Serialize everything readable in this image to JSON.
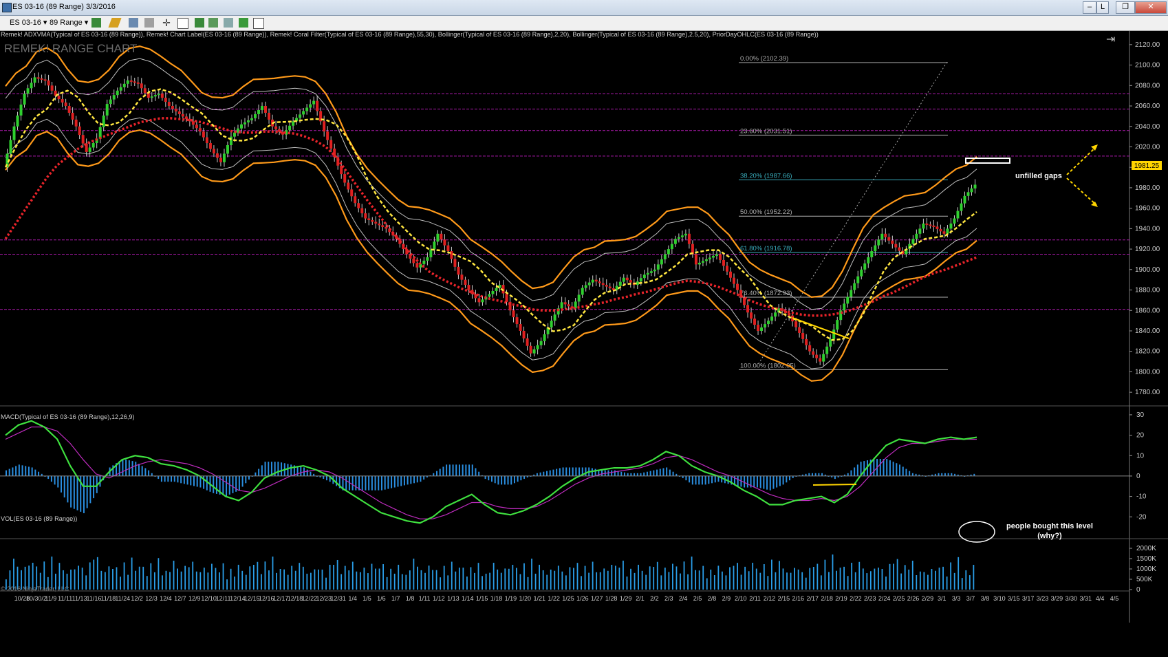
{
  "window": {
    "title": "ES 03-16 (89 Range)  3/3/2016",
    "buttons": [
      "–",
      "L",
      "❐",
      "✕"
    ]
  },
  "toolbar": {
    "instrument": "ES 03-16",
    "period": "89 Range"
  },
  "price_panel": {
    "indicators_label": "Remek! ADXVMA(Typical of ES 03-16 (89 Range)), Remek! Chart Label(ES 03-16 (89 Range)), Remek! Coral Filter(Typical of ES 03-16 (89 Range),55,30), Bollinger(Typical of ES 03-16 (89 Range),2,20), Bollinger(Typical of ES 03-16 (89 Range),2.5,20), PriorDayOHLC(ES 03-16 (89 Range))",
    "watermark": "REMEK! RANGE CHART",
    "current_price": "1981.25",
    "fib_levels": [
      {
        "label": "0.00% (2102.39)",
        "price": 2102.39
      },
      {
        "label": "23.60% (2031.51)",
        "price": 2031.51
      },
      {
        "label": "38.20% (1987.66)",
        "price": 1987.66
      },
      {
        "label": "50.00% (1952.22)",
        "price": 1952.22
      },
      {
        "label": "61.80% (1916.78)",
        "price": 1916.78
      },
      {
        "label": "76.40% (1872.93)",
        "price": 1872.93
      },
      {
        "label": "100.00% (1802.05)",
        "price": 1802.05
      }
    ],
    "annotations": {
      "gaps": "unfilled gaps"
    }
  },
  "macd_panel": {
    "label": "MACD(Typical of ES 03-16 (89 Range),12,26,9)"
  },
  "volume_panel": {
    "label": "VOL(ES 03-16 (89 Range))",
    "note_line1": "people bought this level",
    "note_line2": "(why?)"
  },
  "copyright": "© 2016 NinjaTrader, LLC",
  "chart_data": [
    {
      "type": "line",
      "title": "",
      "ylim": [
        1770,
        2130
      ],
      "y_ticks": [
        "2120.00",
        "2100.00",
        "2080.00",
        "2060.00",
        "2040.00",
        "2020.00",
        "2000.00",
        "1980.00",
        "1960.00",
        "1940.00",
        "1920.00",
        "1900.00",
        "1880.00",
        "1860.00",
        "1840.00",
        "1820.00",
        "1800.00",
        "1780.00"
      ],
      "x_ticks": [
        "10/28",
        "10/30/2",
        "11/9",
        "11/11",
        "11/13",
        "11/16",
        "11/18",
        "11/24",
        "12/2",
        "12/3",
        "12/4",
        "12/7",
        "12/9",
        "12/10",
        "12/11",
        "12/14",
        "12/15",
        "12/16",
        "12/17",
        "12/18",
        "12/22",
        "12/23",
        "12/31",
        "1/4",
        "1/5",
        "1/6",
        "1/7",
        "1/8",
        "1/11",
        "1/12",
        "1/13",
        "1/14",
        "1/15",
        "1/18",
        "1/19",
        "1/20",
        "1/21",
        "1/22",
        "1/25",
        "1/26",
        "1/27",
        "1/28",
        "1/29",
        "2/1",
        "2/2",
        "2/3",
        "2/4",
        "2/5",
        "2/8",
        "2/9",
        "2/10",
        "2/11",
        "2/12",
        "2/15",
        "2/16",
        "2/17",
        "2/18",
        "2/19",
        "2/22",
        "2/23",
        "2/24",
        "2/25",
        "2/26",
        "2/29",
        "3/1",
        "3/3",
        "3/7",
        "3/8",
        "3/10",
        "3/15",
        "3/17",
        "3/23",
        "3/29",
        "3/30",
        "3/31",
        "4/4",
        "4/5"
      ],
      "horizontal_levels": [
        2072,
        2057,
        2036,
        2011,
        1929,
        1915,
        1861
      ],
      "series": [
        {
          "values": [
            2000,
            2040,
            2072,
            2088,
            2085,
            2070,
            2060,
            2040,
            2015,
            2028,
            2062,
            2075,
            2085,
            2082,
            2068,
            2072,
            2060,
            2052,
            2045,
            2035,
            2018,
            2005,
            2030,
            2042,
            2048,
            2060,
            2040,
            2032,
            2045,
            2055,
            2065,
            2035,
            2010,
            1985,
            1965,
            1950,
            1945,
            1940,
            1930,
            1915,
            1902,
            1912,
            1935,
            1918,
            1895,
            1880,
            1868,
            1876,
            1885,
            1860,
            1840,
            1818,
            1830,
            1850,
            1868,
            1862,
            1882,
            1890,
            1885,
            1880,
            1892,
            1885,
            1895,
            1900,
            1915,
            1930,
            1935,
            1905,
            1910,
            1915,
            1898,
            1880,
            1858,
            1840,
            1850,
            1862,
            1855,
            1838,
            1820,
            1810,
            1832,
            1860,
            1880,
            1900,
            1918,
            1935,
            1925,
            1915,
            1930,
            1945,
            1942,
            1935,
            1950,
            1972,
            1983
          ]
        },
        {
          "values": [
            1930,
            1945,
            1960,
            1975,
            1990,
            2002,
            2010,
            2018,
            2024,
            2028,
            2032,
            2036,
            2040,
            2044,
            2046,
            2048,
            2048,
            2047,
            2046,
            2044,
            2041,
            2038,
            2035,
            2034,
            2034,
            2035,
            2035,
            2034,
            2033,
            2030,
            2026,
            2020,
            2010,
            1996,
            1982,
            1968,
            1955,
            1942,
            1930,
            1918,
            1907,
            1898,
            1892,
            1887,
            1882,
            1878,
            1874,
            1871,
            1869,
            1866,
            1864,
            1861,
            1860,
            1860,
            1861,
            1862,
            1864,
            1866,
            1868,
            1871,
            1873,
            1876,
            1878,
            1881,
            1884,
            1887,
            1889,
            1888,
            1886,
            1883,
            1879,
            1875,
            1870,
            1866,
            1863,
            1861,
            1858,
            1856,
            1855,
            1855,
            1856,
            1858,
            1861,
            1865,
            1869,
            1874,
            1878,
            1883,
            1888,
            1893,
            1897,
            1900,
            1904,
            1908,
            1912
          ]
        }
      ]
    },
    {
      "type": "line",
      "title": "",
      "ylim": [
        -28,
        32
      ],
      "y_ticks": [
        "30",
        "20",
        "10",
        "0",
        "-10",
        "-20"
      ],
      "series": [
        {
          "values": [
            20,
            25,
            27,
            24,
            18,
            5,
            -5,
            -5,
            2,
            8,
            10,
            9,
            6,
            5,
            3,
            0,
            -5,
            -10,
            -12,
            -8,
            -1,
            2,
            4,
            5,
            3,
            0,
            -6,
            -10,
            -14,
            -18,
            -20,
            -22,
            -23,
            -20,
            -15,
            -12,
            -9,
            -14,
            -18,
            -19,
            -17,
            -14,
            -10,
            -5,
            -1,
            2,
            3,
            4,
            4,
            5,
            8,
            12,
            10,
            5,
            2,
            0,
            -3,
            -7,
            -10,
            -14,
            -14,
            -12,
            -11,
            -10,
            -13,
            -9,
            0,
            8,
            15,
            18,
            17,
            16,
            18,
            19,
            18,
            19
          ]
        },
        {
          "values": [
            18,
            21,
            24,
            24,
            22,
            16,
            8,
            1,
            -1,
            2,
            5,
            7,
            8,
            7,
            6,
            4,
            1,
            -3,
            -7,
            -8,
            -6,
            -3,
            0,
            2,
            3,
            2,
            -1,
            -5,
            -9,
            -13,
            -16,
            -19,
            -21,
            -21,
            -19,
            -16,
            -13,
            -13,
            -15,
            -16,
            -16,
            -15,
            -12,
            -8,
            -4,
            -1,
            1,
            2,
            3,
            4,
            6,
            9,
            10,
            8,
            5,
            2,
            0,
            -3,
            -6,
            -9,
            -11,
            -12,
            -12,
            -11,
            -12,
            -10,
            -5,
            2,
            9,
            14,
            16,
            16,
            17,
            18,
            18,
            18
          ]
        }
      ]
    },
    {
      "type": "bar",
      "title": "",
      "ylim": [
        0,
        2000000
      ],
      "y_ticks": [
        "2000K",
        "1500K",
        "1000K",
        "500K",
        "0"
      ],
      "values": [
        900000,
        1200000,
        1500000,
        1300000,
        1600000,
        1100000,
        1400000,
        1250000,
        1700000,
        1450000,
        1000000,
        1550000,
        1300000,
        1200000,
        1650000,
        1100000,
        1400000,
        1350000,
        1250000,
        1500000,
        900000,
        1300000,
        1450000,
        1200000,
        1600000,
        1150000,
        1300000,
        1400000,
        1050000,
        1550000,
        1200000,
        1350000,
        1250000,
        1450000,
        1100000,
        1300000,
        1200000,
        1500000,
        950000,
        1350000,
        1250000,
        1150000,
        1400000,
        1050000,
        1300000,
        1200000,
        1500000,
        1100000,
        1300000,
        1250000,
        1400000,
        1050000,
        1350000,
        1200000,
        1650000,
        1150000,
        1300000,
        1450000,
        1100000,
        1250000,
        1600000,
        1350000,
        1000000,
        1250000,
        1400000,
        1150000,
        1300000,
        1450000,
        1200000,
        1500000,
        1050000,
        1350000,
        1100000,
        1700000,
        1300000,
        1200000,
        1450000,
        1150000,
        1600000,
        1250000,
        1400000,
        1000000,
        1300000,
        1150000,
        1700000
      ]
    }
  ]
}
